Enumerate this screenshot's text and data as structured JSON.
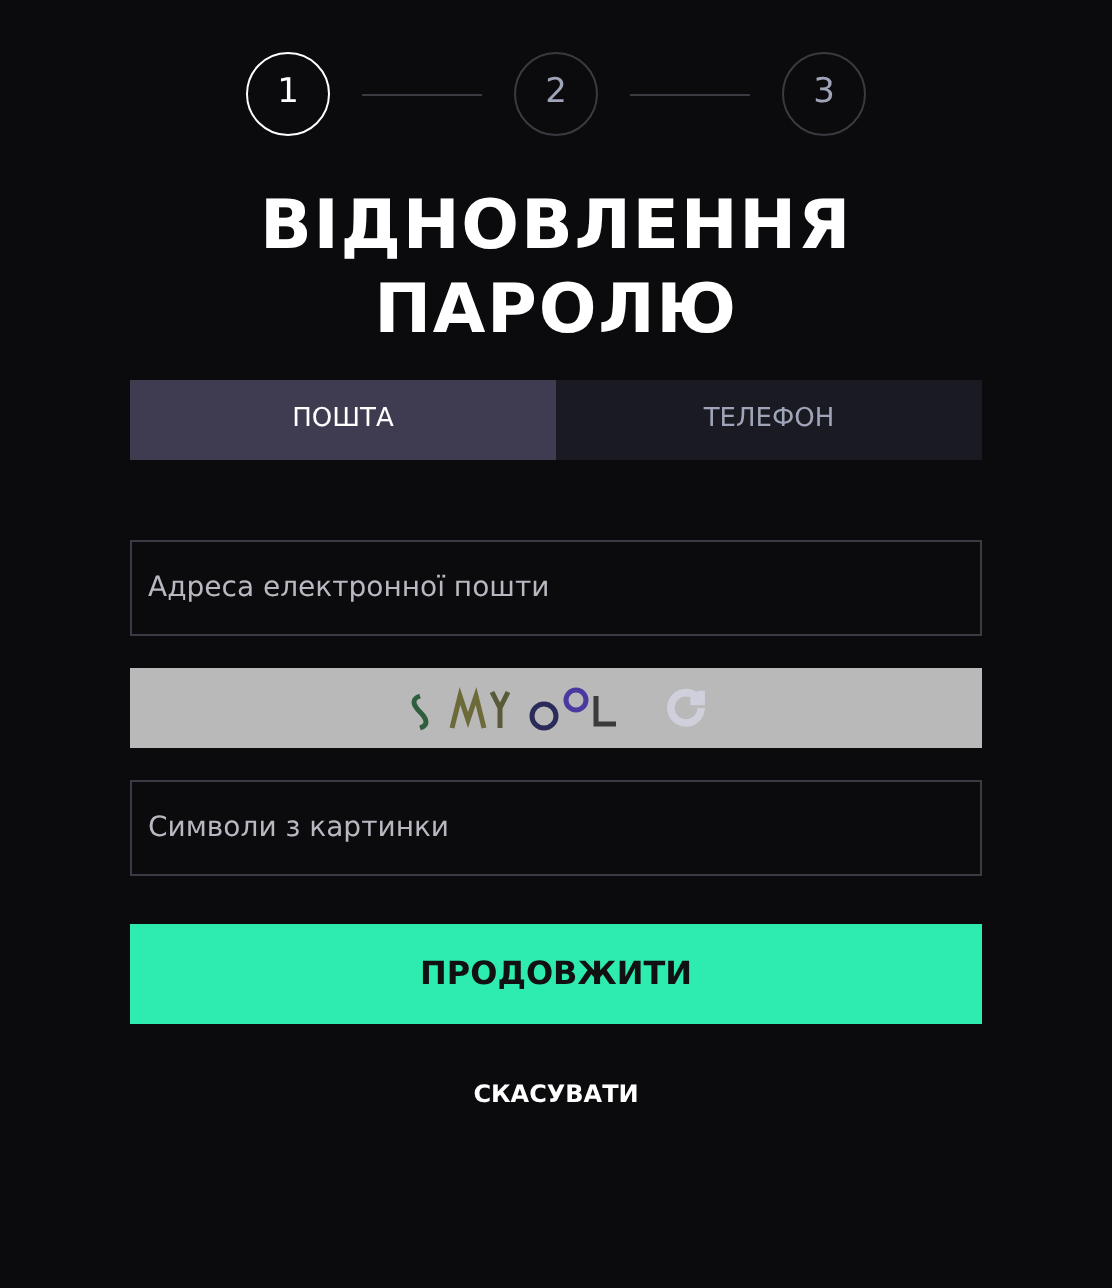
{
  "steps": [
    {
      "label": "1",
      "selected": true
    },
    {
      "label": "2",
      "selected": false
    },
    {
      "label": "3",
      "selected": false
    }
  ],
  "title": "ВІДНОВЛЕННЯ ПАРОЛЮ",
  "tabs": [
    {
      "label": "ПОШТА",
      "selected": true
    },
    {
      "label": "ТЕЛЕФОН",
      "selected": false
    }
  ],
  "email_field": {
    "placeholder": "Адреса електронної пошти"
  },
  "captcha_field": {
    "placeholder": "Символи з картинки"
  },
  "continue_button": "ПРОДОВЖИТИ",
  "cancel_link": "СКАСУВАТИ"
}
